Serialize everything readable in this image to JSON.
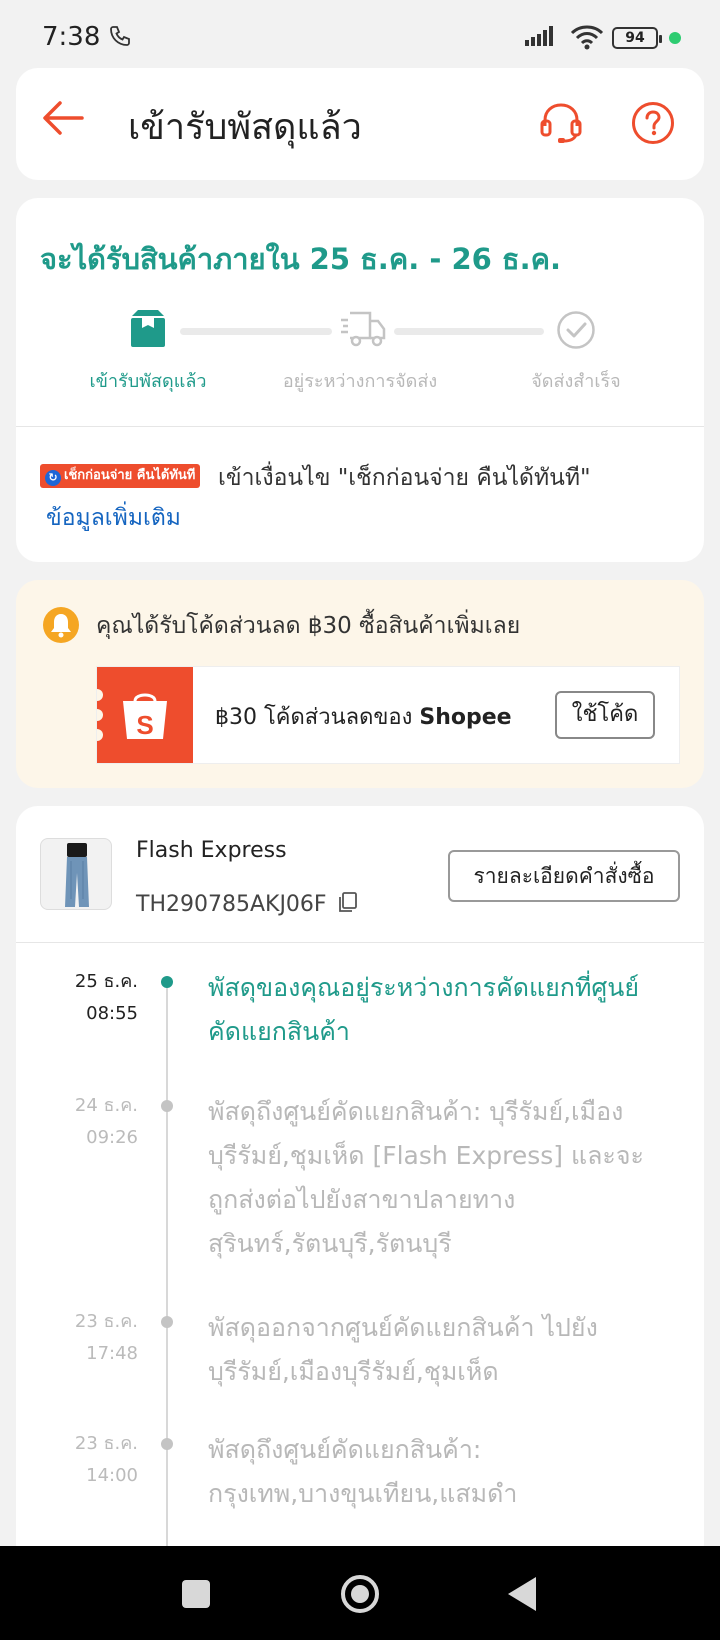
{
  "status_bar": {
    "time": "7:38",
    "battery": "94"
  },
  "header": {
    "title": "เข้ารับพัสดุแล้ว"
  },
  "delivery": {
    "eta": "จะได้รับสินค้าภายใน 25 ธ.ค. - 26 ธ.ค.",
    "steps": [
      {
        "label": "เข้ารับพัสดุแล้ว",
        "icon": "package-icon",
        "active": true
      },
      {
        "label": "อยู่ระหว่างการจัดส่ง",
        "icon": "truck-icon",
        "active": false
      },
      {
        "label": "จัดส่งสำเร็จ",
        "icon": "check-circle-icon",
        "active": false
      }
    ],
    "cod_badge": "เช็กก่อนจ่าย คืนได้ทันที",
    "cod_text": "เข้าเงื่อนไข \"เช็กก่อนจ่าย คืนได้ทันที\"",
    "more_info": "ข้อมูลเพิ่มเติม"
  },
  "voucher": {
    "message": "คุณได้รับโค้ดส่วนลด ฿30 ซื้อสินค้าเพิ่มเลย",
    "ticket_text_prefix": "฿30 โค้ดส่วนลดของ ",
    "ticket_brand": "Shopee",
    "ticket_logo_letter": "S",
    "button": "ใช้โค้ด"
  },
  "shipment": {
    "carrier": "Flash Express",
    "tracking_number": "TH290785AKJ06F",
    "details_button": "รายละเอียดคำสั่งซื้อ"
  },
  "timeline": [
    {
      "date": "25 ธ.ค.",
      "time": "08:55",
      "text": "พัสดุของคุณอยู่ระหว่างการคัดแยกที่ศูนย์คัดแยกสินค้า",
      "active": true
    },
    {
      "date": "24 ธ.ค.",
      "time": "09:26",
      "text": "พัสดุถึงศูนย์คัดแยกสินค้า: บุรีรัมย์,เมืองบุรีรัมย์,ชุมเห็ด  [Flash Express] และจะถูกส่งต่อไปยังสาขาปลายทาง สุรินทร์,รัตนบุรี,รัตนบุรี",
      "active": false
    },
    {
      "date": "23 ธ.ค.",
      "time": "17:48",
      "text": "พัสดุออกจากศูนย์คัดแยกสินค้า ไปยัง บุรีรัมย์,เมืองบุรีรัมย์,ชุมเห็ด",
      "active": false
    },
    {
      "date": "23 ธ.ค.",
      "time": "14:00",
      "text": "พัสดุถึงศูนย์คัดแยกสินค้า: กรุงเทพ,บางขุนเทียน,แสมดำ",
      "active": false
    }
  ],
  "colors": {
    "accent_teal": "#1f9a8a",
    "brand_orange": "#ee4d2d",
    "link_blue": "#1565c0"
  }
}
